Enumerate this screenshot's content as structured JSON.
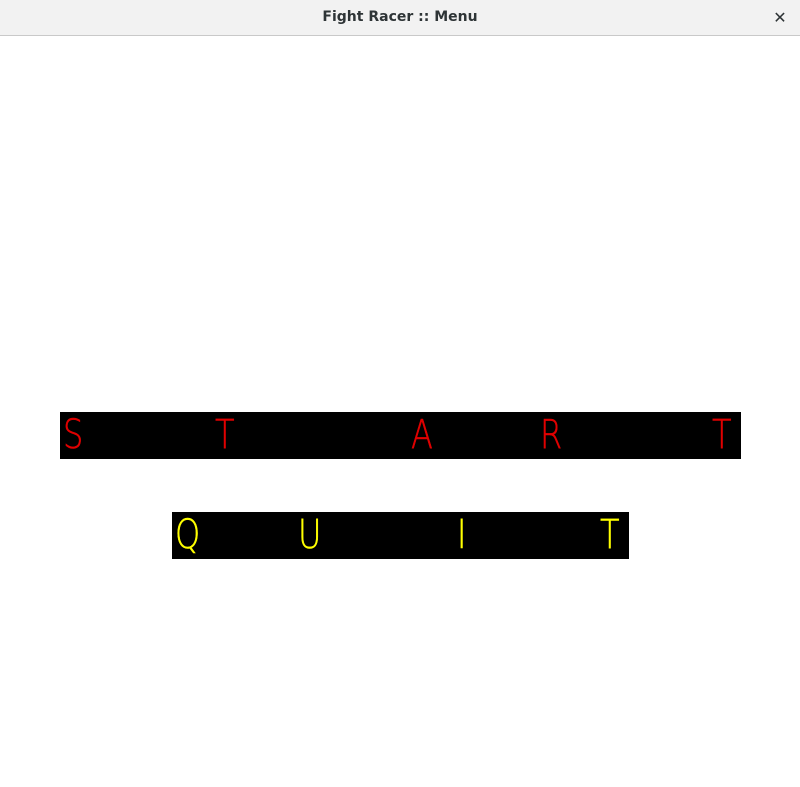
{
  "window": {
    "title": "Fight Racer :: Menu",
    "close_glyph": "✕"
  },
  "menu": {
    "start": {
      "label": "START",
      "letters": [
        "S",
        "T",
        "A",
        "R",
        "T"
      ],
      "color": "#e00000"
    },
    "quit": {
      "label": "QUIT",
      "letters": [
        "Q",
        "U",
        "I",
        "T"
      ],
      "color": "#ffff00"
    }
  }
}
